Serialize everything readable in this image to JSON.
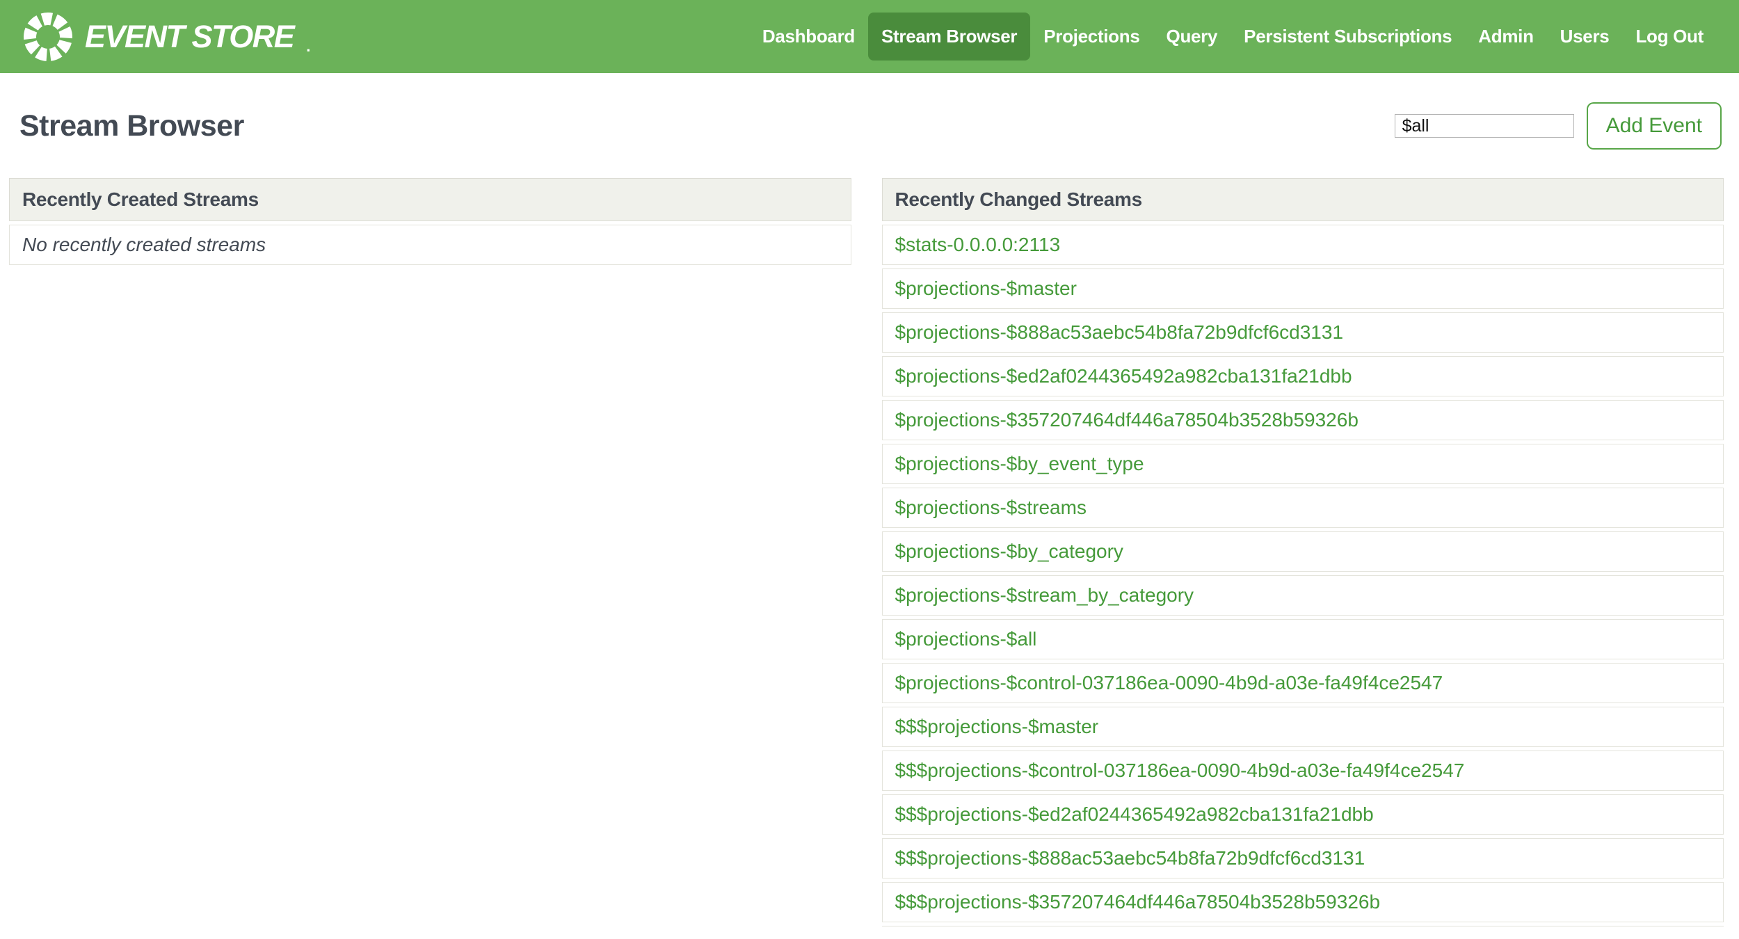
{
  "header": {
    "brand": {
      "name": "EVENT STORE",
      "mark": "."
    },
    "nav": [
      {
        "label": "Dashboard",
        "active": false
      },
      {
        "label": "Stream Browser",
        "active": true
      },
      {
        "label": "Projections",
        "active": false
      },
      {
        "label": "Query",
        "active": false
      },
      {
        "label": "Persistent Subscriptions",
        "active": false
      },
      {
        "label": "Admin",
        "active": false
      },
      {
        "label": "Users",
        "active": false
      },
      {
        "label": "Log Out",
        "active": false
      }
    ]
  },
  "toolbar": {
    "page_title": "Stream Browser",
    "stream_input_value": "$all",
    "add_event_label": "Add Event"
  },
  "panels": {
    "created": {
      "title": "Recently Created Streams",
      "empty_message": "No recently created streams"
    },
    "changed": {
      "title": "Recently Changed Streams",
      "streams": [
        "$stats-0.0.0.0:2113",
        "$projections-$master",
        "$projections-$888ac53aebc54b8fa72b9dfcf6cd3131",
        "$projections-$ed2af0244365492a982cba131fa21dbb",
        "$projections-$357207464df446a78504b3528b59326b",
        "$projections-$by_event_type",
        "$projections-$streams",
        "$projections-$by_category",
        "$projections-$stream_by_category",
        "$projections-$all",
        "$projections-$control-037186ea-0090-4b9d-a03e-fa49f4ce2547",
        "$$$projections-$master",
        "$$$projections-$control-037186ea-0090-4b9d-a03e-fa49f4ce2547",
        "$$$projections-$ed2af0244365492a982cba131fa21dbb",
        "$$$projections-$888ac53aebc54b8fa72b9dfcf6cd3131",
        "$$$projections-$357207464df446a78504b3528b59326b"
      ]
    }
  },
  "colors": {
    "topbar_green": "#6bb259",
    "active_nav_green": "#4a8c3c",
    "link_green": "#459a3a",
    "heading_slate": "#434a54",
    "panel_header_bg": "#f0f1eb",
    "panel_border": "#dcdcd4",
    "row_border": "#e4e4dc",
    "button_border_green": "#58a648",
    "input_border": "#b3b3b3"
  }
}
